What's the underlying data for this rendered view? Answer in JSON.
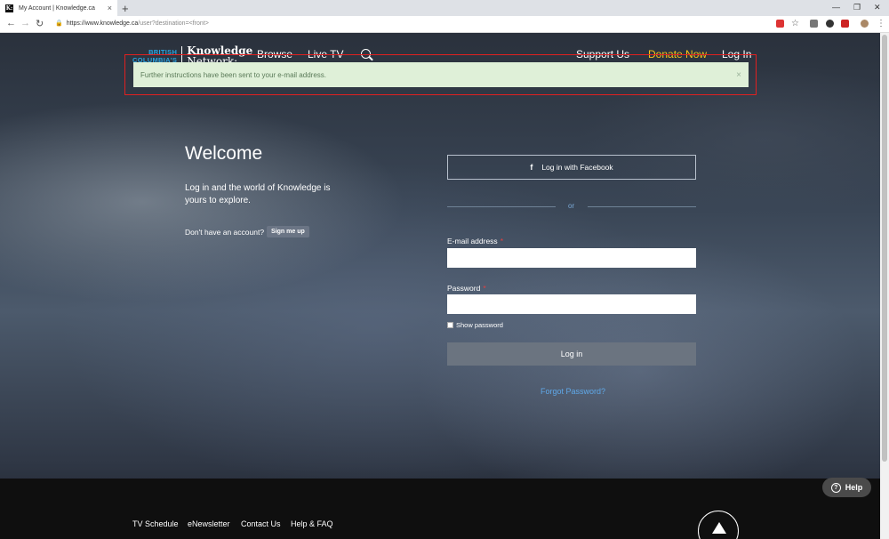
{
  "browser": {
    "tab_title": "My Account | Knowledge.ca",
    "favicon_text": "K:",
    "url_host": "https://www.knowledge.ca",
    "url_path": "/user?destination=<front>"
  },
  "header": {
    "logo_bc_line1": "BRITISH",
    "logo_bc_line2": "COLUMBIA'S",
    "logo_kn_line1": "Knowledge",
    "logo_kn_line2": "Network:",
    "nav_browse": "Browse",
    "nav_livetv": "Live TV",
    "nav_support": "Support Us",
    "nav_donate": "Donate Now",
    "nav_login": "Log In"
  },
  "alert": {
    "message": "Further instructions have been sent to your e-mail address.",
    "close": "×"
  },
  "welcome": {
    "title": "Welcome",
    "subtitle": "Log in and the world of Knowledge is yours to explore.",
    "no_account": "Don't have an account?",
    "signup_label": "Sign me up"
  },
  "login": {
    "facebook_label": "Log in with Facebook",
    "or": "or",
    "email_label": "E-mail address",
    "password_label": "Password",
    "required_mark": "*",
    "show_password": "Show password",
    "login_button": "Log in",
    "forgot": "Forgot Password?"
  },
  "footer": {
    "links": [
      "TV Schedule",
      "eNewsletter",
      "Contact Us",
      "Help & FAQ"
    ],
    "help_label": "Help"
  },
  "colors": {
    "accent_blue": "#2aa3e0",
    "donate_yellow": "#f5c518",
    "alert_bg": "#dff0d8",
    "highlight_red": "#e02020"
  }
}
